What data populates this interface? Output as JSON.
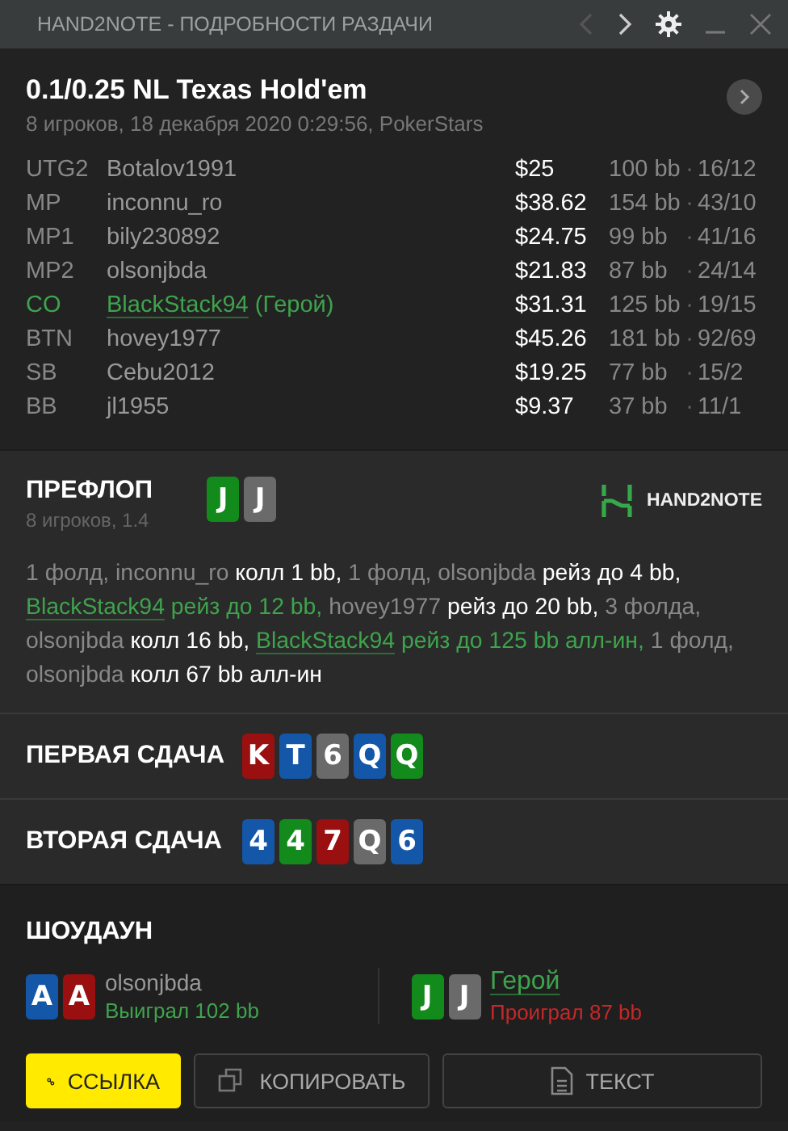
{
  "window": {
    "title": "HAND2NOTE - ПОДРОБНОСТИ РАЗДАЧИ"
  },
  "hand": {
    "title": "0.1/0.25 NL Texas Hold'em",
    "subtitle": "8 игроков, 18 декабря 2020 0:29:56, PokerStars"
  },
  "players": [
    {
      "position": "UTG2",
      "name": "Botalov1991",
      "hero": false,
      "stack": "$25",
      "bb": "100 bb",
      "separator": "·",
      "stats": "16/12"
    },
    {
      "position": "MP",
      "name": "inconnu_ro",
      "hero": false,
      "stack": "$38.62",
      "bb": "154 bb",
      "separator": "·",
      "stats": "43/10"
    },
    {
      "position": "MP1",
      "name": "bily230892",
      "hero": false,
      "stack": "$24.75",
      "bb": "99 bb",
      "separator": "·",
      "stats": "41/16"
    },
    {
      "position": "MP2",
      "name": "olsonjbda",
      "hero": false,
      "stack": "$21.83",
      "bb": "87 bb",
      "separator": "·",
      "stats": "24/14"
    },
    {
      "position": "CO",
      "name": "BlackStack94",
      "hero": true,
      "hero_label": "(Герой)",
      "stack": "$31.31",
      "bb": "125 bb",
      "separator": "·",
      "stats": "19/15"
    },
    {
      "position": "BTN",
      "name": "hovey1977",
      "hero": false,
      "stack": "$45.26",
      "bb": "181 bb",
      "separator": "·",
      "stats": "92/69"
    },
    {
      "position": "SB",
      "name": "Cebu2012",
      "hero": false,
      "stack": "$19.25",
      "bb": "77 bb",
      "separator": "·",
      "stats": "15/2"
    },
    {
      "position": "BB",
      "name": "jl1955",
      "hero": false,
      "stack": "$9.37",
      "bb": "37 bb",
      "separator": "·",
      "stats": "11/1"
    }
  ],
  "preflop": {
    "title": "ПРЕФЛОП",
    "subtitle": "8 игроков, 1.4",
    "logo": "HAND2NOTE",
    "cards": [
      {
        "rank": "J",
        "color": "#138a1c"
      },
      {
        "rank": "J",
        "color": "#6a6a6a"
      }
    ],
    "actions": [
      {
        "kind": "plain",
        "text": "1 фолд, inconnu_ro "
      },
      {
        "kind": "action",
        "text": "колл 1 bb, "
      },
      {
        "kind": "plain",
        "text": "1 фолд, olsonjbda "
      },
      {
        "kind": "action",
        "text": "рейз до 4 bb, "
      },
      {
        "kind": "link",
        "text": "BlackStack94"
      },
      {
        "kind": "hero",
        "text": " рейз до 12 bb, "
      },
      {
        "kind": "plain",
        "text": "hovey1977 "
      },
      {
        "kind": "action",
        "text": "рейз до 20 bb, "
      },
      {
        "kind": "plain",
        "text": "3 фолда, olsonjbda "
      },
      {
        "kind": "action",
        "text": "колл 16 bb, "
      },
      {
        "kind": "link",
        "text": "BlackStack94"
      },
      {
        "kind": "hero",
        "text": " рейз до 125 bb алл-ин, "
      },
      {
        "kind": "plain",
        "text": "1 фолд, olsonjbda "
      },
      {
        "kind": "action",
        "text": "колл 67 bb алл-ин"
      }
    ]
  },
  "runs": [
    {
      "title": "ПЕРВАЯ СДАЧА",
      "cards": [
        {
          "rank": "K",
          "color": "#9a0f0f"
        },
        {
          "rank": "T",
          "color": "#1457a8"
        },
        {
          "rank": "6",
          "color": "#6a6a6a"
        },
        {
          "rank": "Q",
          "color": "#1457a8"
        },
        {
          "rank": "Q",
          "color": "#138a1c"
        }
      ]
    },
    {
      "title": "ВТОРАЯ СДАЧА",
      "cards": [
        {
          "rank": "4",
          "color": "#1457a8"
        },
        {
          "rank": "4",
          "color": "#138a1c"
        },
        {
          "rank": "7",
          "color": "#9a0f0f"
        },
        {
          "rank": "Q",
          "color": "#6a6a6a"
        },
        {
          "rank": "6",
          "color": "#1457a8"
        }
      ]
    }
  ],
  "showdown": {
    "title": "ШОУДАУН",
    "hands": [
      {
        "name": "olsonjbda",
        "hero": false,
        "won": true,
        "result": "Выиграл 102 bb",
        "cards": [
          {
            "rank": "A",
            "color": "#1457a8"
          },
          {
            "rank": "A",
            "color": "#9a0f0f"
          }
        ]
      },
      {
        "name": "Герой",
        "hero": true,
        "won": false,
        "result": "Проиграл 87 bb",
        "cards": [
          {
            "rank": "J",
            "color": "#138a1c"
          },
          {
            "rank": "J",
            "color": "#6a6a6a"
          }
        ]
      }
    ]
  },
  "buttons": [
    {
      "kind": "link",
      "label": "ССЫЛКА",
      "primary": true
    },
    {
      "kind": "copy",
      "label": "КОПИРОВАТЬ",
      "primary": false
    },
    {
      "kind": "text",
      "label": "ТЕКСТ",
      "primary": false
    }
  ]
}
